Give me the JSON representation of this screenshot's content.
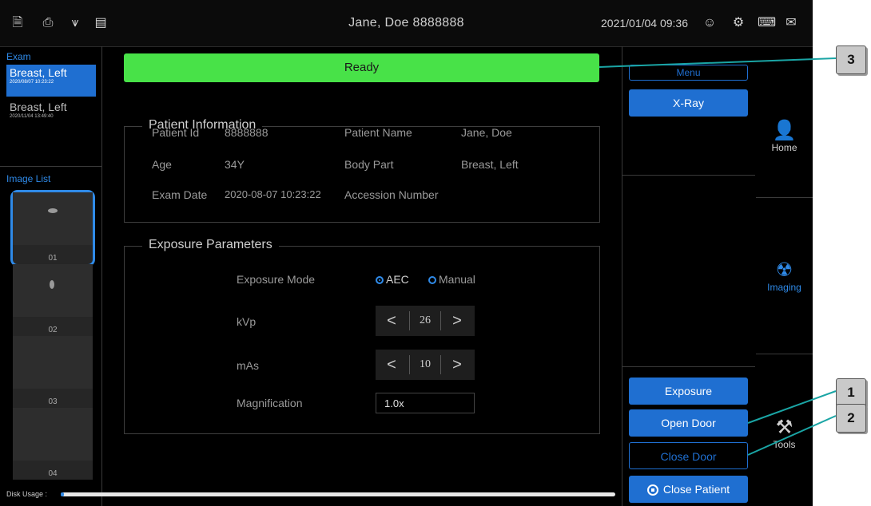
{
  "header": {
    "patient": "Jane, Doe 8888888",
    "datetime": "2021/01/04 09:36",
    "left_icons": [
      "battery-status-icon",
      "printer-icon",
      "device-icon",
      "tray-icon"
    ],
    "right_icons": [
      "user-icon",
      "gear-icon",
      "keyboard-icon",
      "message-icon"
    ]
  },
  "left_panel": {
    "exam_label": "Exam",
    "exams": [
      {
        "title": "Breast, Left",
        "date": "2020/08/07 10:23:22"
      },
      {
        "title": "Breast, Left",
        "date": "2020/11/04 13:49:40"
      }
    ],
    "image_list_label": "Image List",
    "images": [
      "01",
      "02",
      "03",
      "04"
    ],
    "disk_label": "Disk Usage :",
    "disk_usage_fraction": 0.005
  },
  "status": {
    "text": "Ready",
    "color": "#48e248"
  },
  "patient_info": {
    "title": "Patient Information",
    "patient_id_label": "Patient Id",
    "patient_id": "8888888",
    "patient_name_label": "Patient Name",
    "patient_name": "Jane, Doe",
    "age_label": "Age",
    "age": "34Y",
    "body_part_label": "Body Part",
    "body_part": "Breast, Left",
    "exam_date_label": "Exam Date",
    "exam_date": "2020-08-07 10:23:22",
    "accession_label": "Accession Number",
    "accession": ""
  },
  "exposure": {
    "title": "Exposure Parameters",
    "mode_label": "Exposure Mode",
    "mode_options": [
      "AEC",
      "Manual"
    ],
    "mode_selected": "AEC",
    "kvp_label": "kVp",
    "kvp": "26",
    "mas_label": "mAs",
    "mas": "10",
    "mag_label": "Magnification",
    "mag": "1.0x",
    "dec": "<",
    "inc": ">"
  },
  "right_panel": {
    "menu": "Menu",
    "xray": "X-Ray",
    "exposure_btn": "Exposure",
    "open_door": "Open Door",
    "close_door": "Close Door",
    "close_patient": "Close Patient"
  },
  "nav": {
    "home": "Home",
    "imaging": "Imaging",
    "tools": "Tools"
  },
  "callouts": [
    "3",
    "1",
    "2"
  ],
  "colors": {
    "accent": "#1f6fd1",
    "ready": "#48e248",
    "teal_line": "#1aa5a5"
  }
}
